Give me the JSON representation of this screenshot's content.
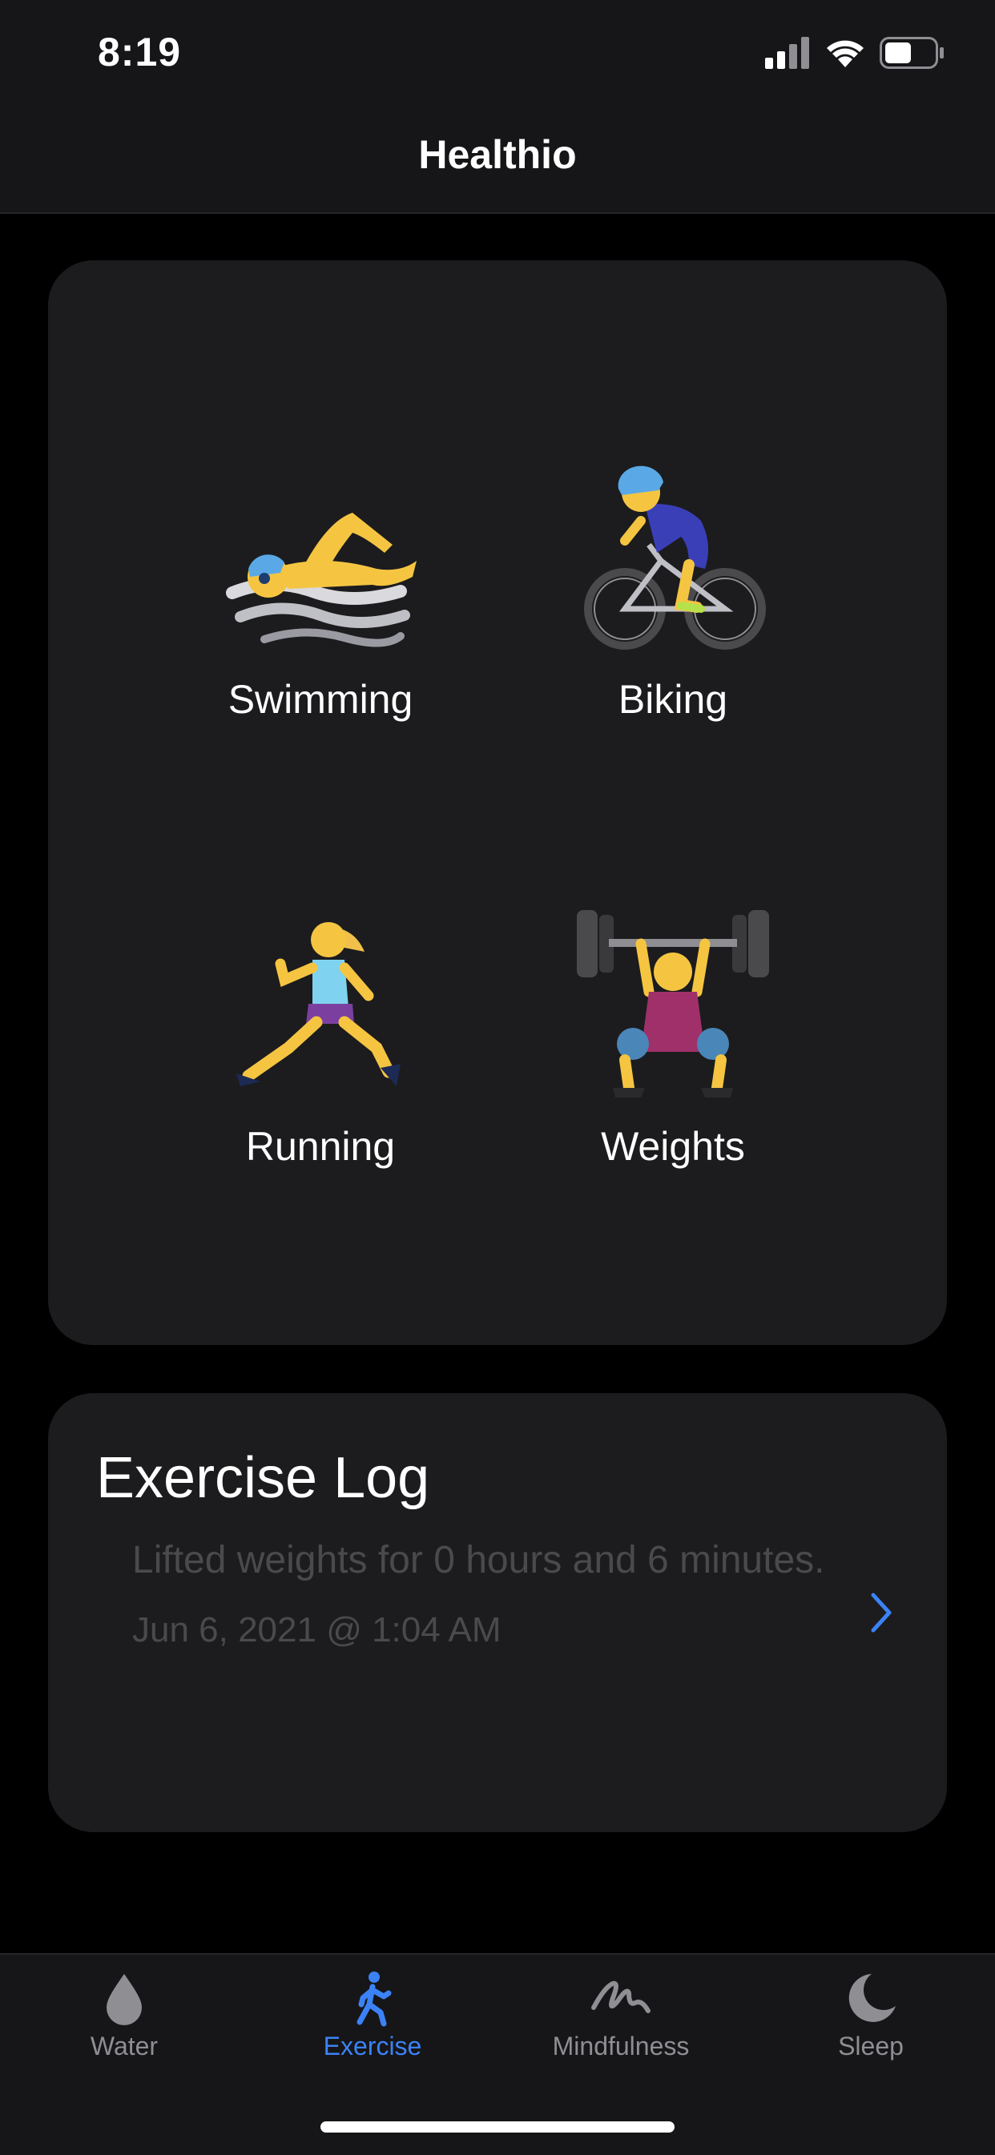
{
  "status_bar": {
    "time": "8:19"
  },
  "header": {
    "title": "Healthio"
  },
  "activities": [
    {
      "label": "Swimming",
      "icon": "swimmer-icon"
    },
    {
      "label": "Biking",
      "icon": "cyclist-icon"
    },
    {
      "label": "Running",
      "icon": "runner-icon"
    },
    {
      "label": "Weights",
      "icon": "weightlifter-icon"
    }
  ],
  "exercise_log": {
    "title": "Exercise Log",
    "entries": [
      {
        "text": "Lifted weights for 0 hours and 6 minutes.",
        "date": "Jun 6, 2021 @ 1:04 AM"
      }
    ]
  },
  "tabs": [
    {
      "label": "Water",
      "icon": "water-drop-icon"
    },
    {
      "label": "Exercise",
      "icon": "walking-figure-icon",
      "active": true
    },
    {
      "label": "Mindfulness",
      "icon": "squiggle-icon"
    },
    {
      "label": "Sleep",
      "icon": "moon-icon"
    }
  ],
  "colors": {
    "accent": "#3b82f6",
    "card": "#1c1c1e",
    "bars": "#161618"
  }
}
